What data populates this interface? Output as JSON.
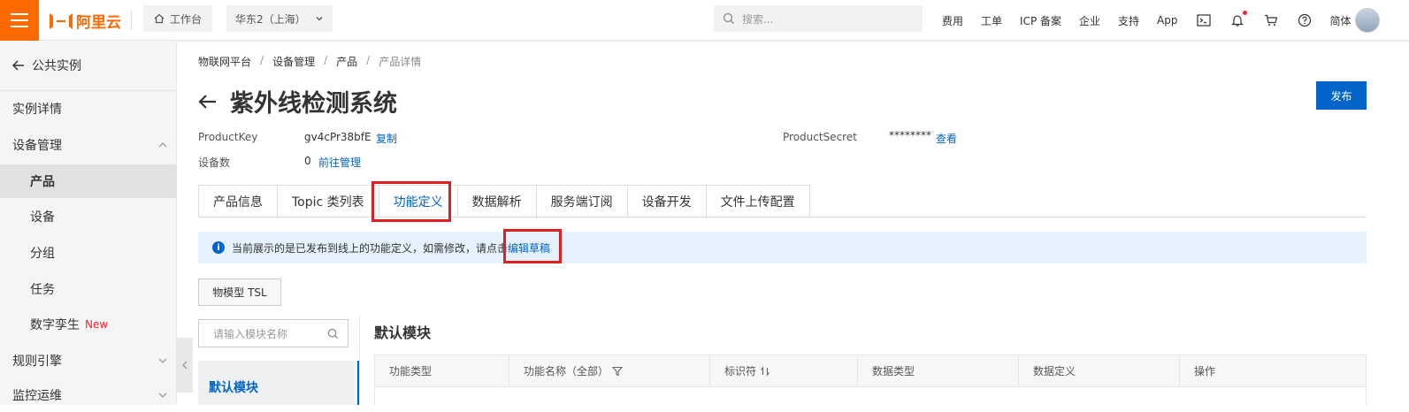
{
  "topbar": {
    "logo_text": "阿里云",
    "workbench": "工作台",
    "region": "华东2（上海）",
    "search_placeholder": "搜索...",
    "nav": [
      "费用",
      "工单",
      "ICP 备案",
      "企业",
      "支持",
      "App"
    ],
    "lang": "简体",
    "accent": "#ff6a00"
  },
  "sidebar": {
    "back_label": "公共实例",
    "items": [
      {
        "label": "实例详情"
      },
      {
        "label": "设备管理"
      },
      {
        "label": "产品"
      },
      {
        "label": "设备"
      },
      {
        "label": "分组"
      },
      {
        "label": "任务"
      },
      {
        "label": "数字孪生",
        "tag": "New"
      },
      {
        "label": "规则引擎"
      },
      {
        "label": "监控运维"
      }
    ]
  },
  "breadcrumb": [
    "物联网平台",
    "设备管理",
    "产品",
    "产品详情"
  ],
  "product": {
    "title": "紫外线检测系统",
    "publish": "发布",
    "key_label": "ProductKey",
    "key_value": "gv4cPr38bfE",
    "copy": "复制",
    "secret_label": "ProductSecret",
    "secret_value": "********",
    "view": "查看",
    "devices_label": "设备数",
    "devices_value": "0",
    "manage": "前往管理"
  },
  "tabs": [
    "产品信息",
    "Topic 类列表",
    "功能定义",
    "数据解析",
    "服务端订阅",
    "设备开发",
    "文件上传配置"
  ],
  "alert": {
    "text": "当前展示的是已发布到线上的功能定义，如需修改，请点击",
    "link": "编辑草稿"
  },
  "tsl_button": "物模型 TSL",
  "module": {
    "search_placeholder": "请输入模块名称",
    "items": [
      "默认模块"
    ],
    "title": "默认模块"
  },
  "table": {
    "headers": [
      "功能类型",
      "功能名称（全部）",
      "标识符",
      "数据类型",
      "数据定义",
      "操作"
    ]
  },
  "colors": {
    "primary": "#0064c8",
    "highlight_box": "#e02020"
  }
}
